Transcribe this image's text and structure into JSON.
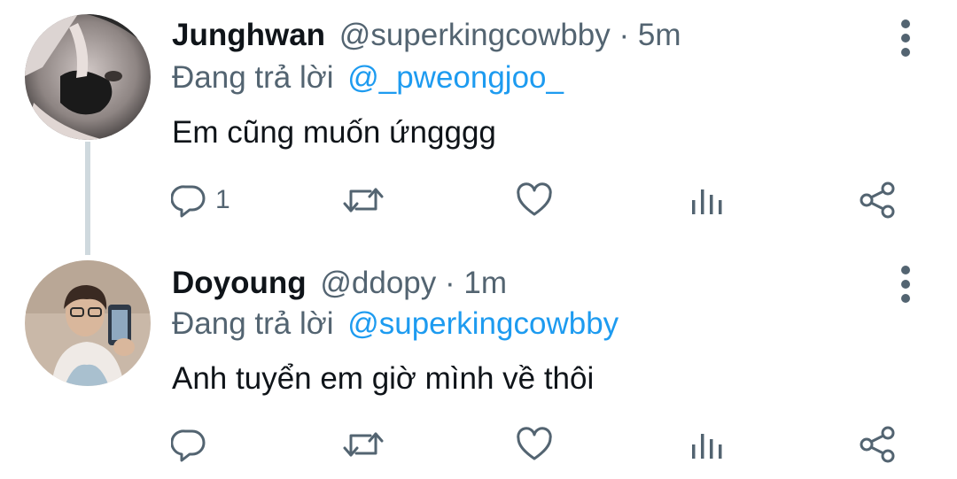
{
  "tweets": [
    {
      "name": "Junghwan",
      "handle": "@superkingcowbby",
      "separator": "·",
      "time": "5m",
      "reply_prefix": "Đang trả lời",
      "reply_to": "@_pweongjoo_",
      "text": "Em cũng muốn ứngggg",
      "reply_count": "1",
      "avatar_icon": "user-avatar-photo"
    },
    {
      "name": "Doyoung",
      "handle": "@ddopy",
      "separator": "·",
      "time": "1m",
      "reply_prefix": "Đang trả lời",
      "reply_to": "@superkingcowbby",
      "text": "Anh tuyển em giờ mình về thôi",
      "reply_count": "",
      "avatar_icon": "user-avatar-photo"
    }
  ],
  "icons": [
    "reply-icon",
    "retweet-icon",
    "like-icon",
    "analytics-icon",
    "share-icon",
    "more-options-icon"
  ],
  "colors": {
    "name": "#0f1419",
    "secondary": "#536471",
    "mention": "#1d9bf0",
    "thread_line": "#cfd9de"
  }
}
